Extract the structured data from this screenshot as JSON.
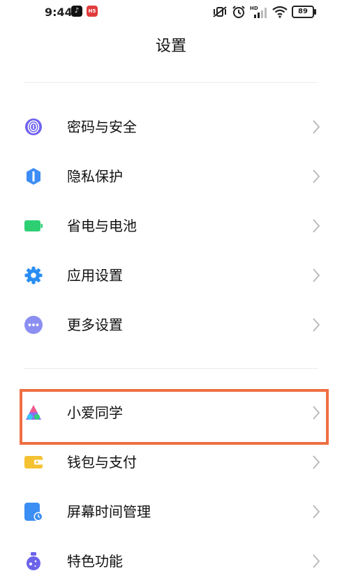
{
  "status_bar": {
    "time": "9:44",
    "app_icons": [
      "tiktok-icon",
      "news-app-icon"
    ],
    "news_app_text": "H5",
    "indicator_icons": [
      "vibrate-off-icon",
      "alarm-icon",
      "hd-signal-icon",
      "wifi-icon"
    ],
    "battery_level": "89"
  },
  "header": {
    "title": "设置"
  },
  "sections": [
    {
      "items": [
        {
          "label": "密码与安全",
          "icon": "fingerprint-icon",
          "color": "#6f63f0"
        },
        {
          "label": "隐私保护",
          "icon": "privacy-shield-icon",
          "color": "#3d8df5"
        },
        {
          "label": "省电与电池",
          "icon": "battery-icon",
          "color": "#2ecf73"
        },
        {
          "label": "应用设置",
          "icon": "gear-icon",
          "color": "#2a8df3"
        },
        {
          "label": "更多设置",
          "icon": "more-dots-icon",
          "color": "#8c8ff1"
        }
      ]
    },
    {
      "items": [
        {
          "label": "小爱同学",
          "icon": "xiaoai-icon",
          "color": "#8b6ff2",
          "highlighted": true
        },
        {
          "label": "钱包与支付",
          "icon": "wallet-icon",
          "color": "#f4c132"
        },
        {
          "label": "屏幕时间管理",
          "icon": "screen-time-icon",
          "color": "#3b8ef3"
        },
        {
          "label": "特色功能",
          "icon": "feature-flask-icon",
          "color": "#6c63ea"
        }
      ]
    }
  ],
  "colors": {
    "highlight_border": "#ef6f43",
    "chevron": "#b7b7b7",
    "divider": "#ececec"
  }
}
